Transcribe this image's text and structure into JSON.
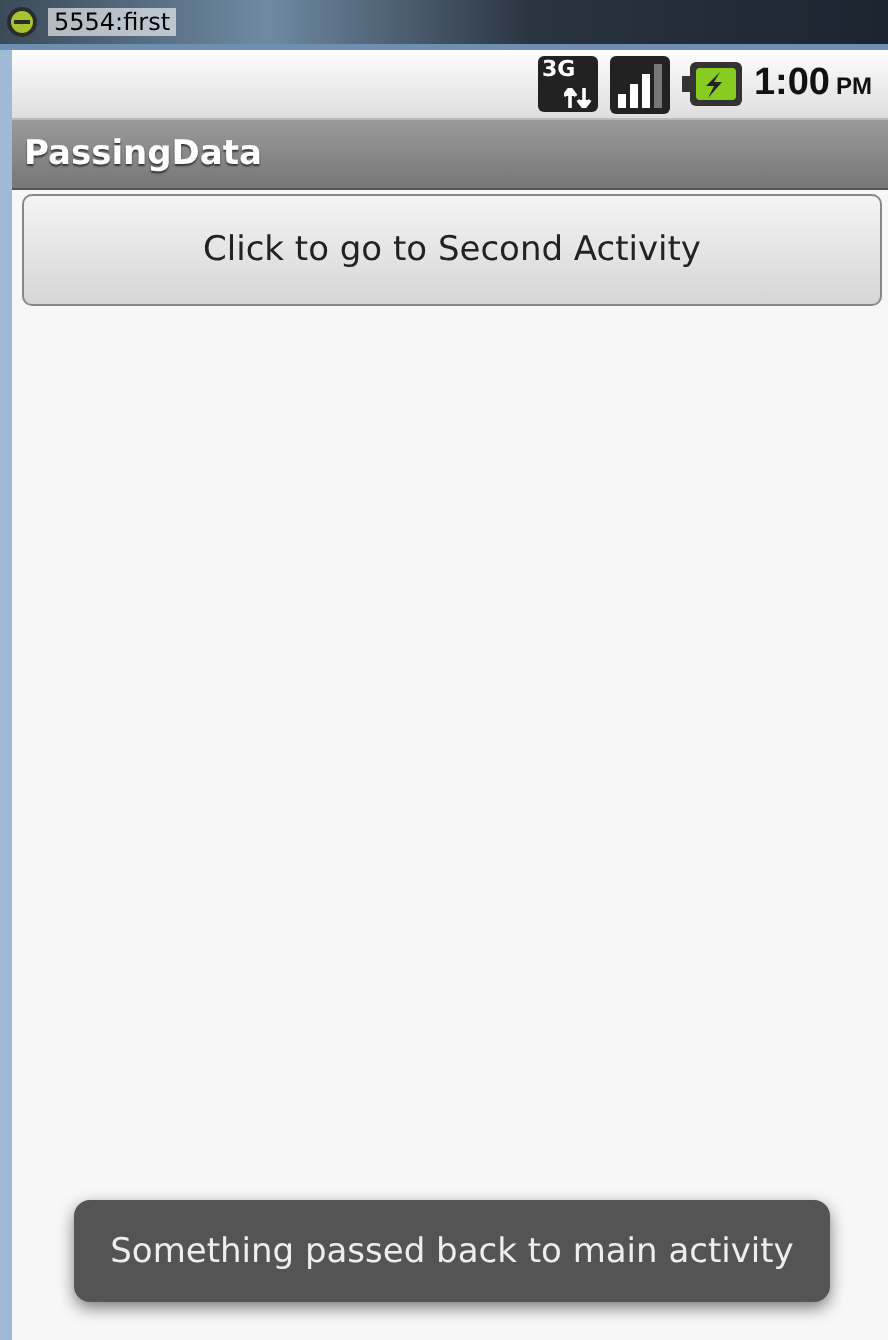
{
  "window": {
    "title": "5554:first"
  },
  "status_bar": {
    "time": "1:00",
    "meridiem": "PM",
    "network": "3G"
  },
  "app_bar": {
    "title": "PassingData"
  },
  "button": {
    "label": "Click to go to Second Activity"
  },
  "toast": {
    "message": "Something passed back to main activity"
  }
}
